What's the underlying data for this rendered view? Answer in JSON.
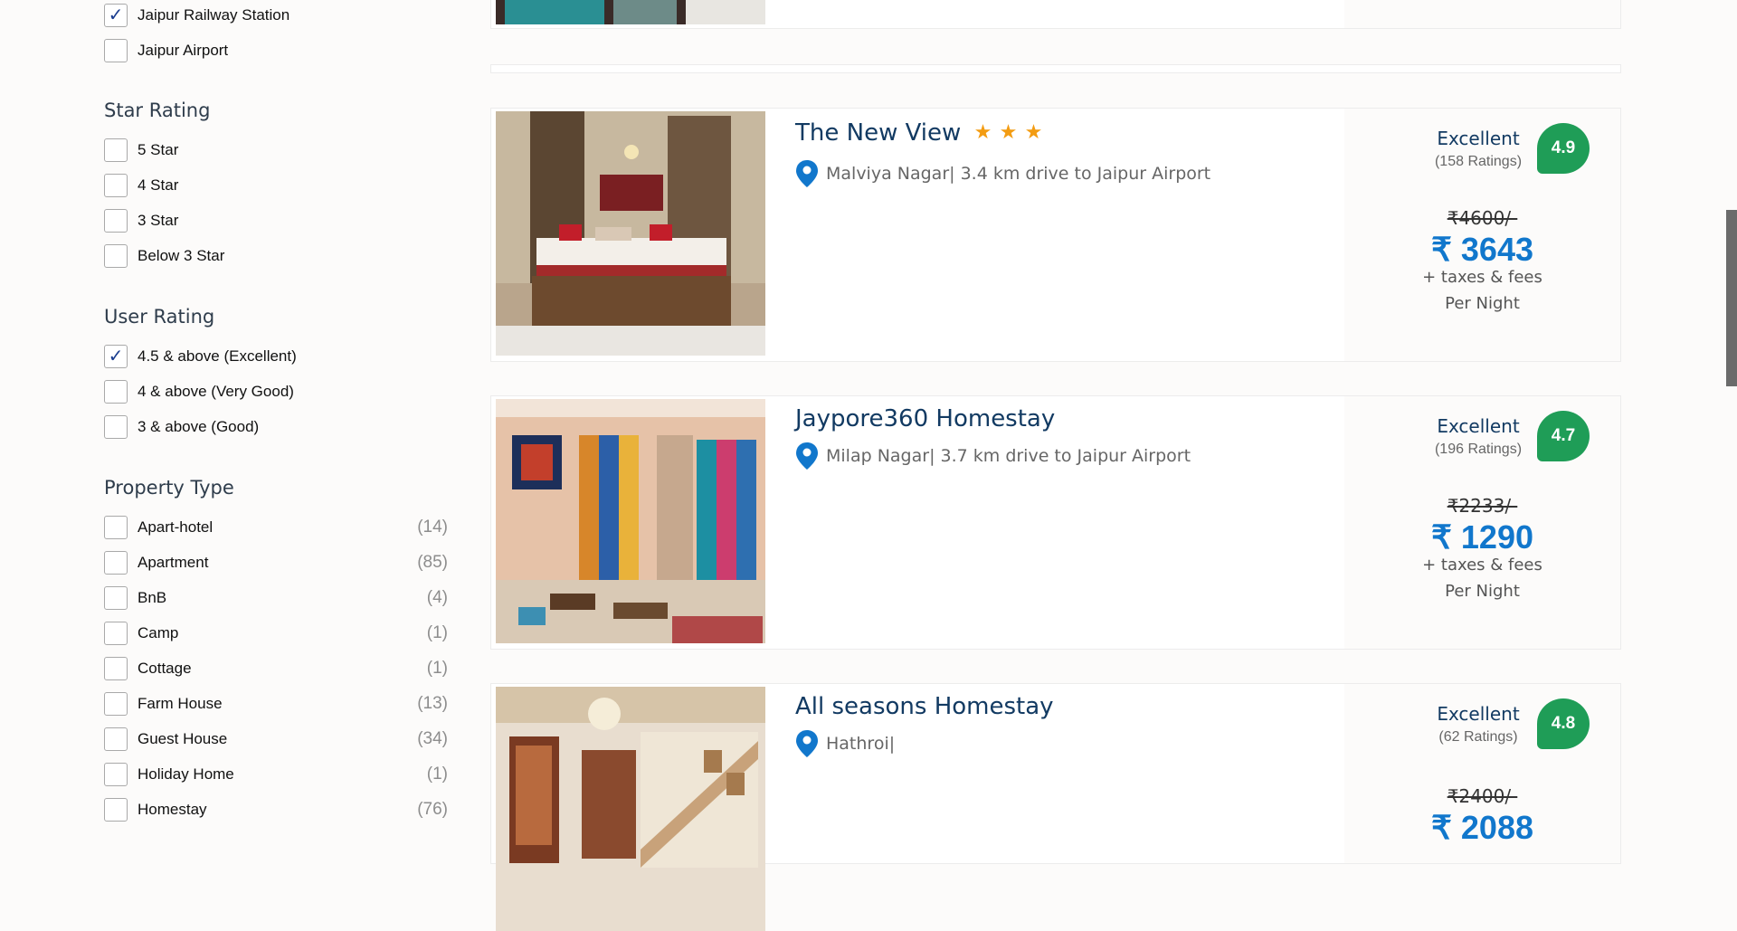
{
  "filters": {
    "landmarks": [
      {
        "label": "Jaipur Railway Station",
        "checked": true
      },
      {
        "label": "Jaipur Airport",
        "checked": false
      }
    ],
    "star_rating": {
      "title": "Star Rating",
      "options": [
        {
          "label": "5 Star",
          "checked": false
        },
        {
          "label": "4 Star",
          "checked": false
        },
        {
          "label": "3 Star",
          "checked": false
        },
        {
          "label": "Below 3 Star",
          "checked": false
        }
      ]
    },
    "user_rating": {
      "title": "User Rating",
      "options": [
        {
          "label": "4.5 & above (Excellent)",
          "checked": true
        },
        {
          "label": "4 & above (Very Good)",
          "checked": false
        },
        {
          "label": "3 & above (Good)",
          "checked": false
        }
      ]
    },
    "property_type": {
      "title": "Property Type",
      "options": [
        {
          "label": "Apart-hotel",
          "count": "(14)",
          "checked": false
        },
        {
          "label": "Apartment",
          "count": "(85)",
          "checked": false
        },
        {
          "label": "BnB",
          "count": "(4)",
          "checked": false
        },
        {
          "label": "Camp",
          "count": "(1)",
          "checked": false
        },
        {
          "label": "Cottage",
          "count": "(1)",
          "checked": false
        },
        {
          "label": "Farm House",
          "count": "(13)",
          "checked": false
        },
        {
          "label": "Guest House",
          "count": "(34)",
          "checked": false
        },
        {
          "label": "Holiday Home",
          "count": "(1)",
          "checked": false
        },
        {
          "label": "Homestay",
          "count": "(76)",
          "checked": false
        }
      ]
    }
  },
  "check_mark": "✓",
  "hotels": [
    {
      "name": "The New View",
      "star_glyph": "★",
      "location": "Malviya Nagar| 3.4 km drive to Jaipur Airport",
      "rating_label": "Excellent",
      "ratings_count": "(158 Ratings)",
      "score": "4.9",
      "old_price": "₹4600/-",
      "price": "₹ 3643",
      "taxes": "+ taxes & fees",
      "per_night": "Per Night"
    },
    {
      "name": "Jaypore360 Homestay",
      "location": "Milap Nagar| 3.7 km drive to Jaipur Airport",
      "rating_label": "Excellent",
      "ratings_count": "(196 Ratings)",
      "score": "4.7",
      "old_price": "₹2233/-",
      "price": "₹ 1290",
      "taxes": "+ taxes & fees",
      "per_night": "Per Night"
    },
    {
      "name": "All seasons Homestay",
      "location": "Hathroi|",
      "rating_label": "Excellent",
      "ratings_count": "(62 Ratings)",
      "score": "4.8",
      "old_price": "₹2400/-",
      "price": "₹ 2088"
    }
  ],
  "colors": {
    "accent": "#1177cc",
    "badge": "#1f9d57",
    "title": "#123a62",
    "star": "#f39c12"
  }
}
